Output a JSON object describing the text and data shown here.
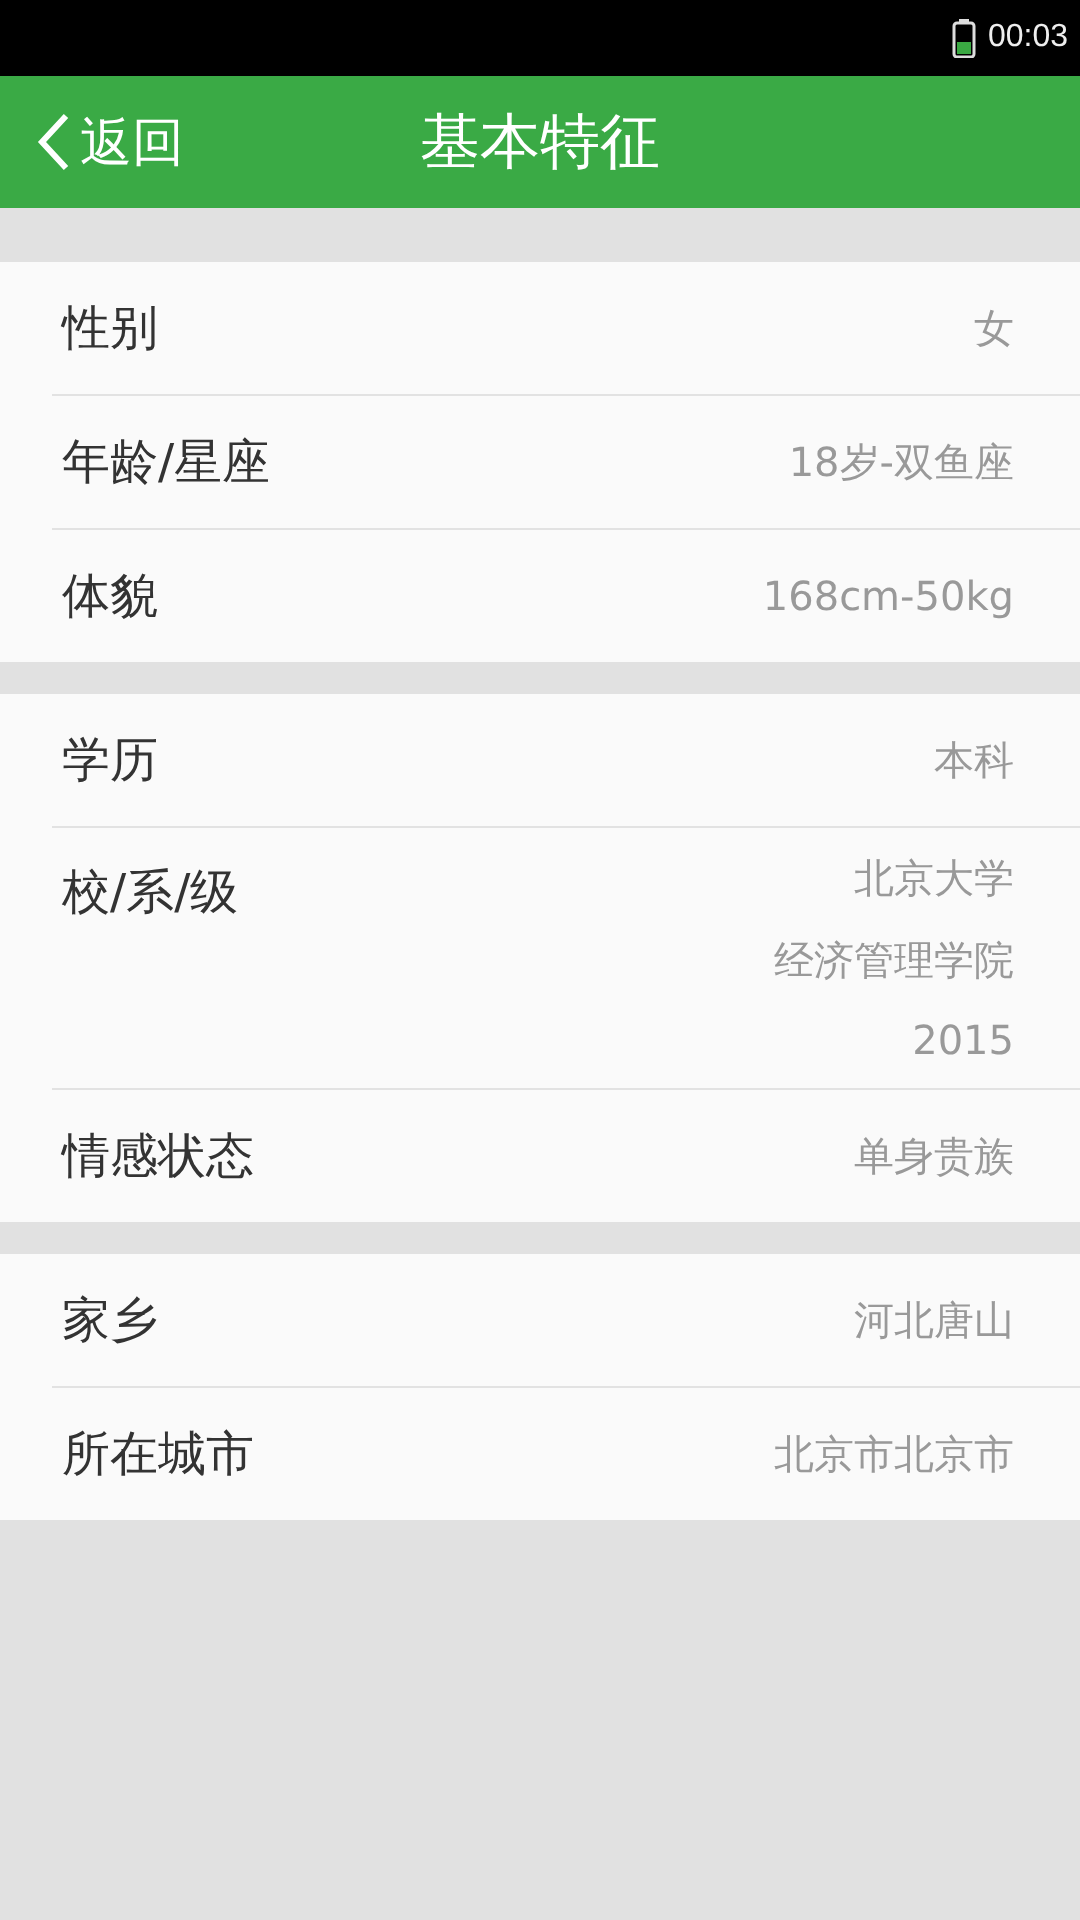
{
  "status_bar": {
    "time": "00:03"
  },
  "header": {
    "back": "返回",
    "title": "基本特征"
  },
  "sections": [
    {
      "rows": [
        {
          "label": "性别",
          "values": [
            "女"
          ]
        },
        {
          "label": "年龄/星座",
          "values": [
            "18岁-双鱼座"
          ]
        },
        {
          "label": "体貌",
          "values": [
            "168cm-50kg"
          ]
        }
      ]
    },
    {
      "rows": [
        {
          "label": "学历",
          "values": [
            "本科"
          ]
        },
        {
          "label": "校/系/级",
          "values": [
            "北京大学",
            "经济管理学院",
            "2015"
          ]
        },
        {
          "label": "情感状态",
          "values": [
            "单身贵族"
          ]
        }
      ]
    },
    {
      "rows": [
        {
          "label": "家乡",
          "values": [
            "河北唐山"
          ]
        },
        {
          "label": "所在城市",
          "values": [
            "北京市北京市"
          ]
        }
      ]
    }
  ]
}
